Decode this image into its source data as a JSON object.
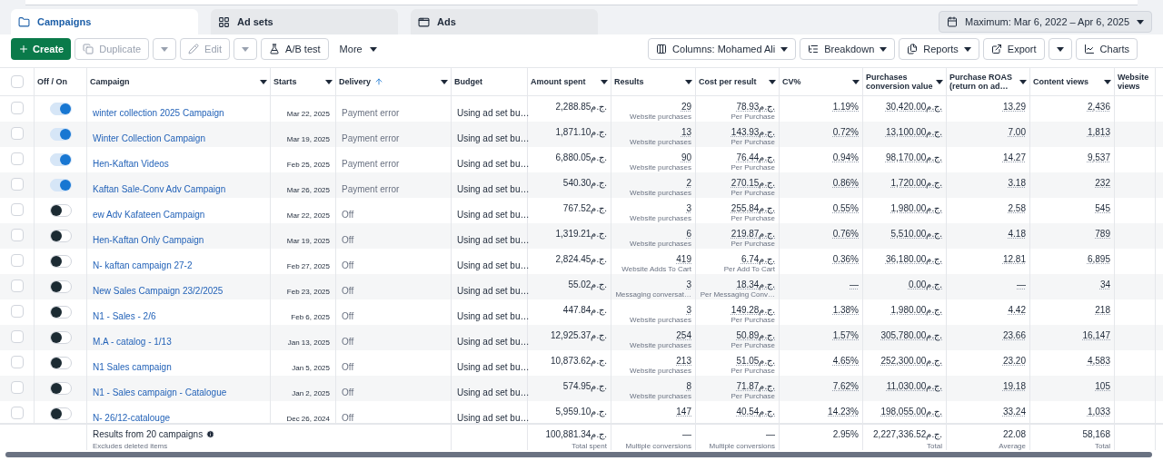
{
  "tabs": [
    {
      "label": "Campaigns",
      "selected": true
    },
    {
      "label": "Ad sets",
      "selected": false
    },
    {
      "label": "Ads",
      "selected": false
    }
  ],
  "date_range": "Maximum: Mar 6, 2022 – Apr 6, 2025",
  "toolbar_left": [
    {
      "kind": "primary",
      "label": "Create",
      "disabled": false
    },
    {
      "kind": "button",
      "label": "Duplicate",
      "disabled": true
    },
    {
      "kind": "caret",
      "disabled": true
    },
    {
      "kind": "button",
      "label": "Edit",
      "disabled": true
    },
    {
      "kind": "caret",
      "disabled": true
    },
    {
      "kind": "button",
      "label": "A/B test",
      "disabled": false
    },
    {
      "kind": "plain",
      "label": "More",
      "disabled": false
    }
  ],
  "toolbar_right": [
    {
      "label": "Columns: Mohamed Ali"
    },
    {
      "label": "Breakdown"
    },
    {
      "label": "Reports"
    },
    {
      "label": "Export"
    },
    {
      "label": "Charts"
    }
  ],
  "select_all": {
    "checked": false
  },
  "columns": [
    {
      "label": "Off / On",
      "menu": false,
      "sorted": false
    },
    {
      "label": "Campaign",
      "menu": true,
      "sorted": false
    },
    {
      "label": "Starts",
      "menu": true,
      "sorted": false
    },
    {
      "label": "Delivery",
      "menu": true,
      "sorted": true
    },
    {
      "label": "Budget",
      "menu": false,
      "sorted": false
    },
    {
      "label": "Amount spent",
      "menu": true,
      "sorted": false
    },
    {
      "label": "Results",
      "menu": true,
      "sorted": false
    },
    {
      "label": "Cost per result",
      "menu": true,
      "sorted": false
    },
    {
      "label": "CV%",
      "menu": true,
      "sorted": false
    },
    {
      "label": "Purchases conversion value",
      "menu": true,
      "sorted": false
    },
    {
      "label": "Purchase ROAS (return on ad…",
      "menu": true,
      "sorted": false
    },
    {
      "label": "Content views",
      "menu": true,
      "sorted": false
    },
    {
      "label": "Website views",
      "sorted": false
    }
  ],
  "rows": [
    {
      "checked": false,
      "on": true,
      "campaign": "winter collection 2025 Campaign",
      "starts": "Mar 22, 2025",
      "delivery": "Payment error",
      "budget": "Using ad set bu…",
      "spent": "2,288.85ج.م.",
      "results": "29",
      "results_sub": "Website purchases",
      "cost": "78.93ج.م.",
      "cost_sub": "Per Purchase",
      "cv": "1.19%",
      "pcv": "30,420.00ج.م.",
      "roas": "13.29",
      "views": "2,436"
    },
    {
      "checked": false,
      "on": true,
      "campaign": "Winter Collection Campaign",
      "starts": "Mar 19, 2025",
      "delivery": "Payment error",
      "budget": "Using ad set bu…",
      "spent": "1,871.10ج.م.",
      "results": "13",
      "results_sub": "Website purchases",
      "cost": "143.93ج.م.",
      "cost_sub": "Per Purchase",
      "cv": "0.72%",
      "pcv": "13,100.00ج.م.",
      "roas": "7.00",
      "views": "1,813"
    },
    {
      "checked": false,
      "on": true,
      "campaign": "Hen-Kaftan Videos",
      "starts": "Feb 25, 2025",
      "delivery": "Payment error",
      "budget": "Using ad set bu…",
      "spent": "6,880.05ج.م.",
      "results": "90",
      "results_sub": "Website purchases",
      "cost": "76.44ج.م.",
      "cost_sub": "Per Purchase",
      "cv": "0.94%",
      "pcv": "98,170.00ج.م.",
      "roas": "14.27",
      "views": "9,537"
    },
    {
      "checked": false,
      "on": true,
      "campaign": "Kaftan Sale-Conv Adv Campaign",
      "starts": "Mar 26, 2025",
      "delivery": "Payment error",
      "budget": "Using ad set bu…",
      "spent": "540.30ج.م.",
      "results": "2",
      "results_sub": "Website purchases",
      "cost": "270.15ج.م.",
      "cost_sub": "Per Purchase",
      "cv": "0.86%",
      "pcv": "1,720.00ج.م.",
      "roas": "3.18",
      "views": "232"
    },
    {
      "checked": false,
      "on": false,
      "campaign": "ew Adv Kafateen Campaign",
      "starts": "Mar 22, 2025",
      "delivery": "Off",
      "budget": "Using ad set bu…",
      "spent": "767.52ج.م.",
      "results": "3",
      "results_sub": "Website purchases",
      "cost": "255.84ج.م.",
      "cost_sub": "Per Purchase",
      "cv": "0.55%",
      "pcv": "1,980.00ج.م.",
      "roas": "2.58",
      "views": "545"
    },
    {
      "checked": false,
      "on": false,
      "campaign": "Hen-Kaftan Only Campaign",
      "starts": "Mar 19, 2025",
      "delivery": "Off",
      "budget": "Using ad set bu…",
      "spent": "1,319.21ج.م.",
      "results": "6",
      "results_sub": "Website purchases",
      "cost": "219.87ج.م.",
      "cost_sub": "Per Purchase",
      "cv": "0.76%",
      "pcv": "5,510.00ج.م.",
      "roas": "4.18",
      "views": "789"
    },
    {
      "checked": false,
      "on": false,
      "campaign": "N- kaftan campaign 27-2",
      "starts": "Feb 27, 2025",
      "delivery": "Off",
      "budget": "Using ad set bu…",
      "spent": "2,824.45ج.م.",
      "results": "419",
      "results_sub": "Website Adds To Cart",
      "cost": "6.74ج.م.",
      "cost_sub": "Per Add To Cart",
      "cv": "0.36%",
      "pcv": "36,180.00ج.م.",
      "roas": "12.81",
      "views": "6,895"
    },
    {
      "checked": false,
      "on": false,
      "campaign": "New Sales Campaign 23/2/2025",
      "starts": "Feb 23, 2025",
      "delivery": "Off",
      "budget": "Using ad set bu…",
      "spent": "55.02ج.م.",
      "results": "3",
      "results_sub": "Messaging conversat…",
      "cost": "18.34ج.م.",
      "cost_sub": "Per Messaging Conv…",
      "cv": "—",
      "pcv": "0.00ج.م.",
      "roas": "—",
      "views": "34"
    },
    {
      "checked": false,
      "on": false,
      "campaign": "N1 - Sales - 2/6",
      "starts": "Feb 6, 2025",
      "delivery": "Off",
      "budget": "Using ad set bu…",
      "spent": "447.84ج.م.",
      "results": "3",
      "results_sub": "Website purchases",
      "cost": "149.28ج.م.",
      "cost_sub": "Per Purchase",
      "cv": "1.38%",
      "pcv": "1,980.00ج.م.",
      "roas": "4.42",
      "views": "218"
    },
    {
      "checked": false,
      "on": false,
      "campaign": "M.A - catalog - 1/13",
      "starts": "Jan 13, 2025",
      "delivery": "Off",
      "budget": "Using ad set bu…",
      "spent": "12,925.37ج.م.",
      "results": "254",
      "results_sub": "Website purchases",
      "cost": "50.89ج.م.",
      "cost_sub": "Per Purchase",
      "cv": "1.57%",
      "pcv": "305,780.00ج.م.",
      "roas": "23.66",
      "views": "16,147"
    },
    {
      "checked": false,
      "on": false,
      "campaign": "N1 Sales campaign",
      "starts": "Jan 5, 2025",
      "delivery": "Off",
      "budget": "Using ad set bu…",
      "spent": "10,873.62ج.م.",
      "results": "213",
      "results_sub": "Website purchases",
      "cost": "51.05ج.م.",
      "cost_sub": "Per Purchase",
      "cv": "4.65%",
      "pcv": "252,300.00ج.م.",
      "roas": "23.20",
      "views": "4,583"
    },
    {
      "checked": false,
      "on": false,
      "campaign": "N1 - Sales campaign - Catalogue",
      "starts": "Jan 2, 2025",
      "delivery": "Off",
      "budget": "Using ad set bu…",
      "spent": "574.95ج.م.",
      "results": "8",
      "results_sub": "Website purchases",
      "cost": "71.87ج.م.",
      "cost_sub": "Per Purchase",
      "cv": "7.62%",
      "pcv": "11,030.00ج.م.",
      "roas": "19.18",
      "views": "105"
    },
    {
      "checked": false,
      "on": false,
      "campaign": "N- 26/12-catalouge",
      "starts": "Dec 26, 2024",
      "delivery": "Off",
      "budget": "Using ad set bu…",
      "spent": "5,959.10ج.م.",
      "results": "147",
      "cost": "40.54ج.م.",
      "cv": "14.23%",
      "pcv": "198,055.00ج.م.",
      "roas": "33.24",
      "views": "1,033"
    }
  ],
  "footer": {
    "title": "Results from 20 campaigns",
    "note": "Excludes deleted items",
    "totals": [
      {
        "value": "100,881.34ج.م.",
        "label": "Total spent"
      },
      {
        "value": "—",
        "label": "Multiple conversions"
      },
      {
        "value": "—",
        "label": "Multiple conversions"
      },
      {
        "value": "2.95%"
      },
      {
        "value": "2,227,336.52ج.م.",
        "label": "Total"
      },
      {
        "value": "22.08",
        "label": "Average"
      },
      {
        "value": "58,168",
        "label": "Total"
      }
    ]
  }
}
